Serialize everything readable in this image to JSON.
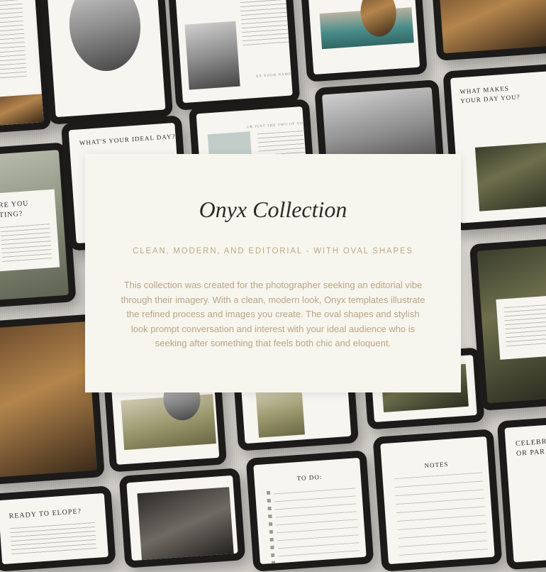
{
  "card": {
    "title": "Onyx Collection",
    "subtitle": "CLEAN, MODERN, AND EDITORIAL - WITH OVAL SHAPES",
    "description": "This collection was created for the photographer seeking an editorial vibe through their imagery. With a clean, modern look, Onyx templates illustrate the refined process and images you create. The oval shapes and stylish look prompt conversation and interest with your ideal audience who is seeking after something that feels both chic and eloquent."
  },
  "mockups": {
    "ideal_day": "WHAT'S YOUR IDEAL DAY?",
    "makes_your_day": "WHAT MAKES YOUR DAY YOU?",
    "you_getting_1": "RE YOU",
    "you_getting_2": "TING?",
    "just_two": "OR JUST THE TWO OF YOU",
    "xx_your_name": "XX YOUR NAME",
    "ready_to_elope": "READY TO ELOPE?",
    "to_do": "TO DO:",
    "notes": "NOTES",
    "celebrate_1": "CELEBR",
    "celebrate_2": "OR PAR"
  },
  "colors": {
    "background": "#d8d5cf",
    "card": "#f7f6ee",
    "title": "#2c2a26",
    "accent_text": "#bba887",
    "body_text": "#b9a486"
  }
}
